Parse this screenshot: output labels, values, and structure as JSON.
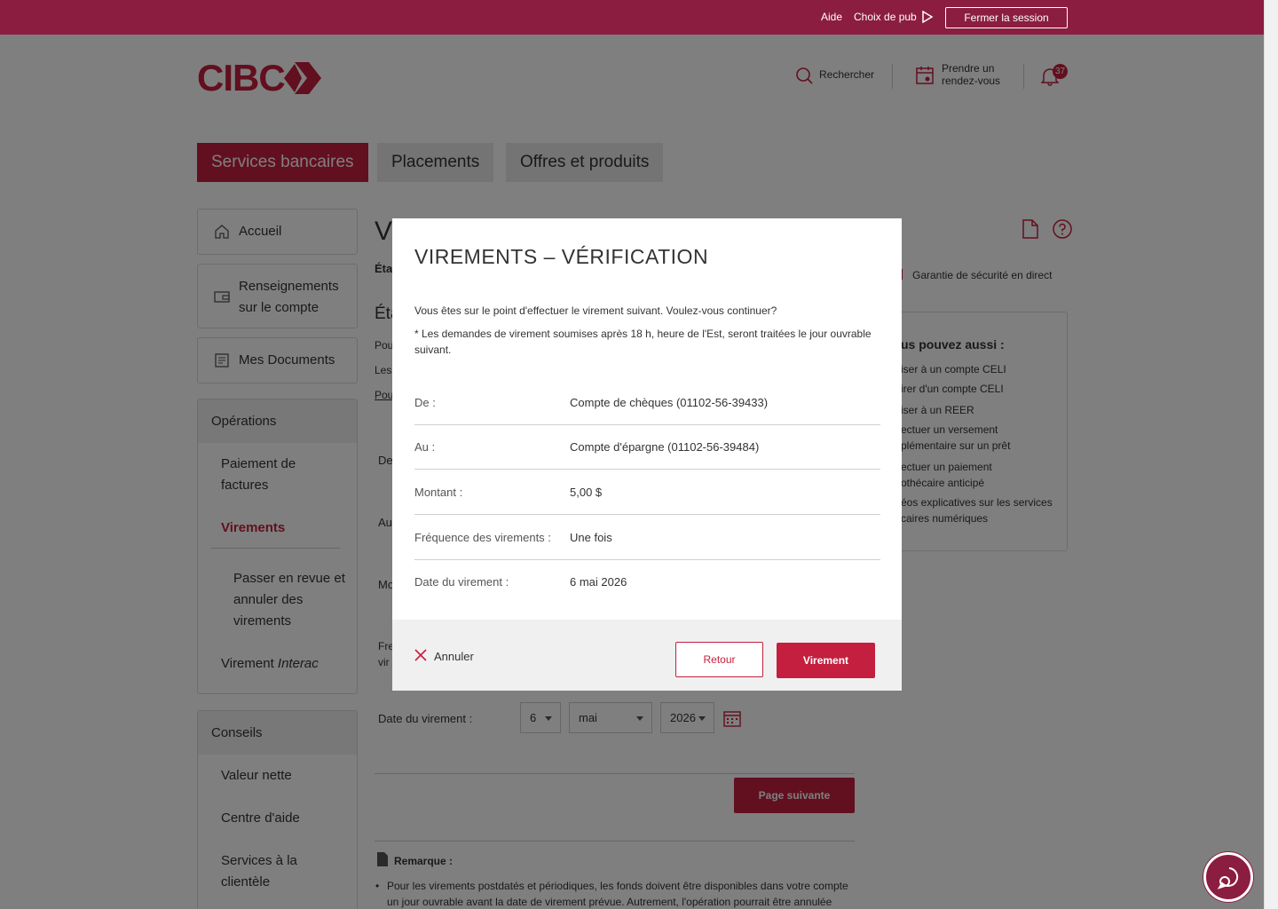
{
  "topbar": {
    "help": "Aide",
    "ad_choice": "Choix de pub",
    "logout": "Fermer la session"
  },
  "header": {
    "logo": "CIBC",
    "search": "Rechercher",
    "appointment_line1": "Prendre un",
    "appointment_line2": "rendez-vous",
    "notifications_count": "37"
  },
  "main_tabs": [
    {
      "label": "Services bancaires",
      "active": true
    },
    {
      "label": "Placements",
      "active": false
    },
    {
      "label": "Offres et produits",
      "active": false
    }
  ],
  "sidebar": {
    "home": "Accueil",
    "account_info_line1": "Renseignements",
    "account_info_line2": "sur le compte",
    "documents": "Mes Documents",
    "operations_heading": "Opérations",
    "bill_payment_line1": "Paiement de",
    "bill_payment_line2": "factures",
    "transfers": "Virements",
    "review_line1": "Passer en revue et",
    "review_line2": "annuler des",
    "review_line3": "virements",
    "interac_prefix": "Virement ",
    "interac_italic": "Interac",
    "advice_heading": "Conseils",
    "net_worth": "Valeur nette",
    "help_centre": "Centre d'aide",
    "client_services_line1": "Services à la",
    "client_services_line2": "clientèle"
  },
  "background": {
    "page_title_fragment": "V",
    "subtitle_fragment": "Éta",
    "section_fragment": "Éta",
    "line_pou": "Pou",
    "line_les": "Les",
    "line_pou2": "Pou",
    "row_de": "De",
    "row_au": "Au",
    "row_mo": "Mo",
    "row_fre": "Fre",
    "row_vir": "vir",
    "date_label": "Date du virement :",
    "day": "6",
    "month": "mai",
    "year": "2026",
    "next_button": "Page suivante",
    "note_title": "Remarque :",
    "note_line1": "Pour les virements postdatés et périodiques, les fonds doivent être disponibles dans votre compte",
    "note_line2": "un jour ouvrable avant la date de virement prévue. Autrement, l'opération pourrait être annulée",
    "security": "Garantie de sécurité en direct",
    "panel_title": "us pouvez aussi :",
    "panel_items": [
      "iser à un compte CELI",
      "irer d'un compte CELI",
      "iser à un REER",
      "ectuer un versement",
      "plémentaire sur un prêt",
      "ectuer un paiement",
      "othécaire anticipé",
      "éos explicatives sur les services",
      "caires numériques"
    ]
  },
  "modal": {
    "title": "VIREMENTS – VÉRIFICATION",
    "intro": "Vous êtes sur le point d'effectuer le virement suivant. Voulez-vous continuer?",
    "note": "* Les demandes de virement soumises après 18 h, heure de l'Est, seront traitées le jour ouvrable suivant.",
    "rows": [
      {
        "label": "De :",
        "value": "Compte de chèques (01102-56-39433)"
      },
      {
        "label": "Au :",
        "value": "Compte d'épargne (01102-56-39484)"
      },
      {
        "label": "Montant :",
        "value": "5,00 $"
      },
      {
        "label": "Fréquence des virements :",
        "value": "Une fois"
      },
      {
        "label": "Date du virement :",
        "value": "6 mai 2026"
      }
    ],
    "cancel": "Annuler",
    "back": "Retour",
    "confirm": "Virement"
  },
  "colors": {
    "brand": "#c41f3e",
    "topbar": "#8b1d41"
  }
}
